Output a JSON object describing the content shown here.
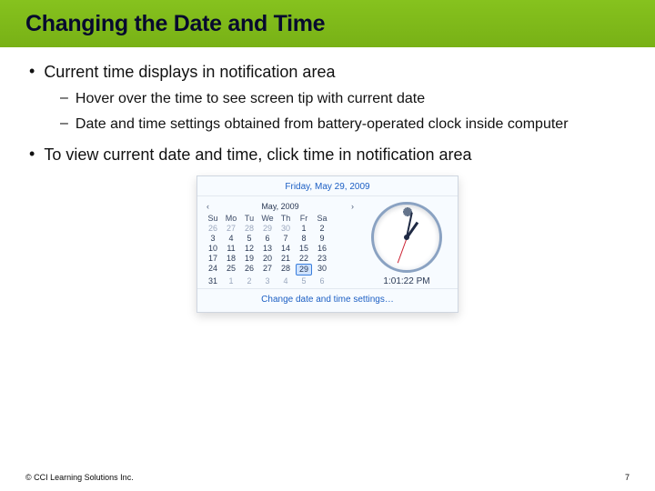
{
  "title": "Changing the Date and Time",
  "bullets": [
    {
      "text": "Current time displays in notification area",
      "sub": [
        "Hover over the time to see screen tip with current date",
        "Date and time settings obtained from battery-operated clock inside computer"
      ]
    },
    {
      "text": "To view current date and time, click time in notification area",
      "sub": []
    }
  ],
  "popup": {
    "long_date": "Friday, May 29, 2009",
    "month_label": "May, 2009",
    "nav_prev": "‹",
    "nav_next": "›",
    "dow": [
      "Su",
      "Mo",
      "Tu",
      "We",
      "Th",
      "Fr",
      "Sa"
    ],
    "weeks": [
      [
        {
          "d": "26",
          "m": true
        },
        {
          "d": "27",
          "m": true
        },
        {
          "d": "28",
          "m": true
        },
        {
          "d": "29",
          "m": true
        },
        {
          "d": "30",
          "m": true
        },
        {
          "d": "1"
        },
        {
          "d": "2"
        }
      ],
      [
        {
          "d": "3"
        },
        {
          "d": "4"
        },
        {
          "d": "5"
        },
        {
          "d": "6"
        },
        {
          "d": "7"
        },
        {
          "d": "8"
        },
        {
          "d": "9"
        }
      ],
      [
        {
          "d": "10"
        },
        {
          "d": "11"
        },
        {
          "d": "12"
        },
        {
          "d": "13"
        },
        {
          "d": "14"
        },
        {
          "d": "15"
        },
        {
          "d": "16"
        }
      ],
      [
        {
          "d": "17"
        },
        {
          "d": "18"
        },
        {
          "d": "19"
        },
        {
          "d": "20"
        },
        {
          "d": "21"
        },
        {
          "d": "22"
        },
        {
          "d": "23"
        }
      ],
      [
        {
          "d": "24"
        },
        {
          "d": "25"
        },
        {
          "d": "26"
        },
        {
          "d": "27"
        },
        {
          "d": "28"
        },
        {
          "d": "29",
          "sel": true
        },
        {
          "d": "30"
        }
      ],
      [
        {
          "d": "31"
        },
        {
          "d": "1",
          "m": true
        },
        {
          "d": "2",
          "m": true
        },
        {
          "d": "3",
          "m": true
        },
        {
          "d": "4",
          "m": true
        },
        {
          "d": "5",
          "m": true
        },
        {
          "d": "6",
          "m": true
        }
      ]
    ],
    "clock_time": "1:01:22 PM",
    "link": "Change date and time settings…"
  },
  "footer": {
    "copyright": "© CCI Learning Solutions Inc.",
    "page": "7"
  },
  "glyphs": {
    "bullet": "•",
    "dash": "–"
  }
}
